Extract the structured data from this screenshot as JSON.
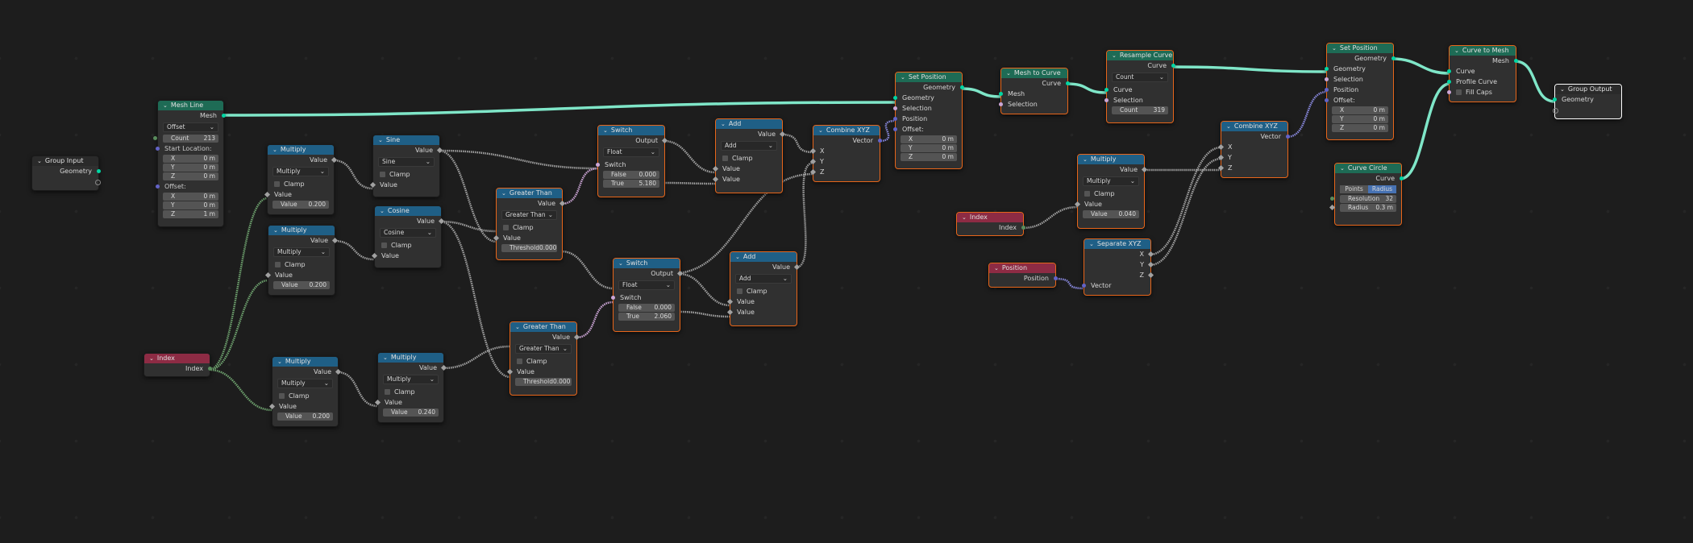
{
  "nodes": {
    "group_input": {
      "title": "Group Input",
      "outputs": [
        "Geometry"
      ]
    },
    "mesh_line": {
      "title": "Mesh Line",
      "output": "Mesh",
      "mode": "Offset",
      "count_label": "Count",
      "count": "213",
      "start_label": "Start Location:",
      "start": [
        {
          "axis": "X",
          "value": "0 m"
        },
        {
          "axis": "Y",
          "value": "0 m"
        },
        {
          "axis": "Z",
          "value": "0 m"
        }
      ],
      "offset_label": "Offset:",
      "offset": [
        {
          "axis": "X",
          "value": "0 m"
        },
        {
          "axis": "Y",
          "value": "0 m"
        },
        {
          "axis": "Z",
          "value": "1 m"
        }
      ]
    },
    "multiply1": {
      "title": "Multiply",
      "output": "Value",
      "op": "Multiply",
      "clamp": "Clamp",
      "input": "Value",
      "value_label": "Value",
      "value": "0.200"
    },
    "multiply2": {
      "title": "Multiply",
      "output": "Value",
      "op": "Multiply",
      "clamp": "Clamp",
      "input": "Value",
      "value_label": "Value",
      "value": "0.200"
    },
    "multiply3": {
      "title": "Multiply",
      "output": "Value",
      "op": "Multiply",
      "clamp": "Clamp",
      "input": "Value",
      "value_label": "Value",
      "value": "0.200"
    },
    "multiply4": {
      "title": "Multiply",
      "output": "Value",
      "op": "Multiply",
      "clamp": "Clamp",
      "input": "Value",
      "value_label": "Value",
      "value": "0.240"
    },
    "index1": {
      "title": "Index",
      "output": "Index"
    },
    "sine": {
      "title": "Sine",
      "output": "Value",
      "op": "Sine",
      "clamp": "Clamp",
      "input": "Value"
    },
    "cosine": {
      "title": "Cosine",
      "output": "Value",
      "op": "Cosine",
      "clamp": "Clamp",
      "input": "Value"
    },
    "greater1": {
      "title": "Greater Than",
      "output": "Value",
      "op": "Greater Than",
      "clamp": "Clamp",
      "input": "Value",
      "threshold_label": "Threshold",
      "threshold": "0.000"
    },
    "greater2": {
      "title": "Greater Than",
      "output": "Value",
      "op": "Greater Than",
      "clamp": "Clamp",
      "input": "Value",
      "threshold_label": "Threshold",
      "threshold": "0.000"
    },
    "switch1": {
      "title": "Switch",
      "output": "Output",
      "type": "Float",
      "switch": "Switch",
      "false_label": "False",
      "false": "0.000",
      "true_label": "True",
      "true": "5.180"
    },
    "switch2": {
      "title": "Switch",
      "output": "Output",
      "type": "Float",
      "switch": "Switch",
      "false_label": "False",
      "false": "0.000",
      "true_label": "True",
      "true": "2.060"
    },
    "add1": {
      "title": "Add",
      "output": "Value",
      "op": "Add",
      "clamp": "Clamp",
      "inputs": [
        "Value",
        "Value"
      ]
    },
    "add2": {
      "title": "Add",
      "output": "Value",
      "op": "Add",
      "clamp": "Clamp",
      "inputs": [
        "Value",
        "Value"
      ]
    },
    "combine1": {
      "title": "Combine XYZ",
      "output": "Vector",
      "inputs": [
        "X",
        "Y",
        "Z"
      ]
    },
    "set_position1": {
      "title": "Set Position",
      "output": "Geometry",
      "inputs": [
        "Geometry",
        "Selection",
        "Position"
      ],
      "offset_label": "Offset:",
      "offset": [
        {
          "axis": "X",
          "value": "0 m"
        },
        {
          "axis": "Y",
          "value": "0 m"
        },
        {
          "axis": "Z",
          "value": "0 m"
        }
      ]
    },
    "mesh_to_curve": {
      "title": "Mesh to Curve",
      "output": "Curve",
      "inputs": [
        "Mesh",
        "Selection"
      ]
    },
    "resample": {
      "title": "Resample Curve",
      "output": "Curve",
      "mode": "Count",
      "inputs": [
        "Curve",
        "Selection"
      ],
      "count_label": "Count",
      "count": "319"
    },
    "index2": {
      "title": "Index",
      "output": "Index"
    },
    "position": {
      "title": "Position",
      "output": "Position"
    },
    "multiply5": {
      "title": "Multiply",
      "output": "Value",
      "op": "Multiply",
      "clamp": "Clamp",
      "input": "Value",
      "value_label": "Value",
      "value": "0.040"
    },
    "separate": {
      "title": "Separate XYZ",
      "outputs": [
        "X",
        "Y",
        "Z"
      ],
      "input": "Vector"
    },
    "combine2": {
      "title": "Combine XYZ",
      "output": "Vector",
      "inputs": [
        "X",
        "Y",
        "Z"
      ]
    },
    "set_position2": {
      "title": "Set Position",
      "output": "Geometry",
      "inputs": [
        "Geometry",
        "Selection",
        "Position"
      ],
      "offset_label": "Offset:",
      "offset": [
        {
          "axis": "X",
          "value": "0 m"
        },
        {
          "axis": "Y",
          "value": "0 m"
        },
        {
          "axis": "Z",
          "value": "0 m"
        }
      ]
    },
    "curve_circle": {
      "title": "Curve Circle",
      "output": "Curve",
      "mode_a": "Points",
      "mode_b": "Radius",
      "resolution_label": "Resolution",
      "resolution": "32",
      "radius_label": "Radius",
      "radius": "0.3 m"
    },
    "curve_to_mesh": {
      "title": "Curve to Mesh",
      "output": "Mesh",
      "inputs": [
        "Curve",
        "Profile Curve"
      ],
      "fill_caps": "Fill Caps"
    },
    "group_output": {
      "title": "Group Output",
      "inputs": [
        "Geometry"
      ]
    }
  },
  "colors": {
    "geometry_edge": "#7fe6c8",
    "float_edge": "#a1a1a1",
    "vector_edge": "#8a8ae0",
    "int_edge": "#6fa36f",
    "selected_border": "#e8661a"
  }
}
